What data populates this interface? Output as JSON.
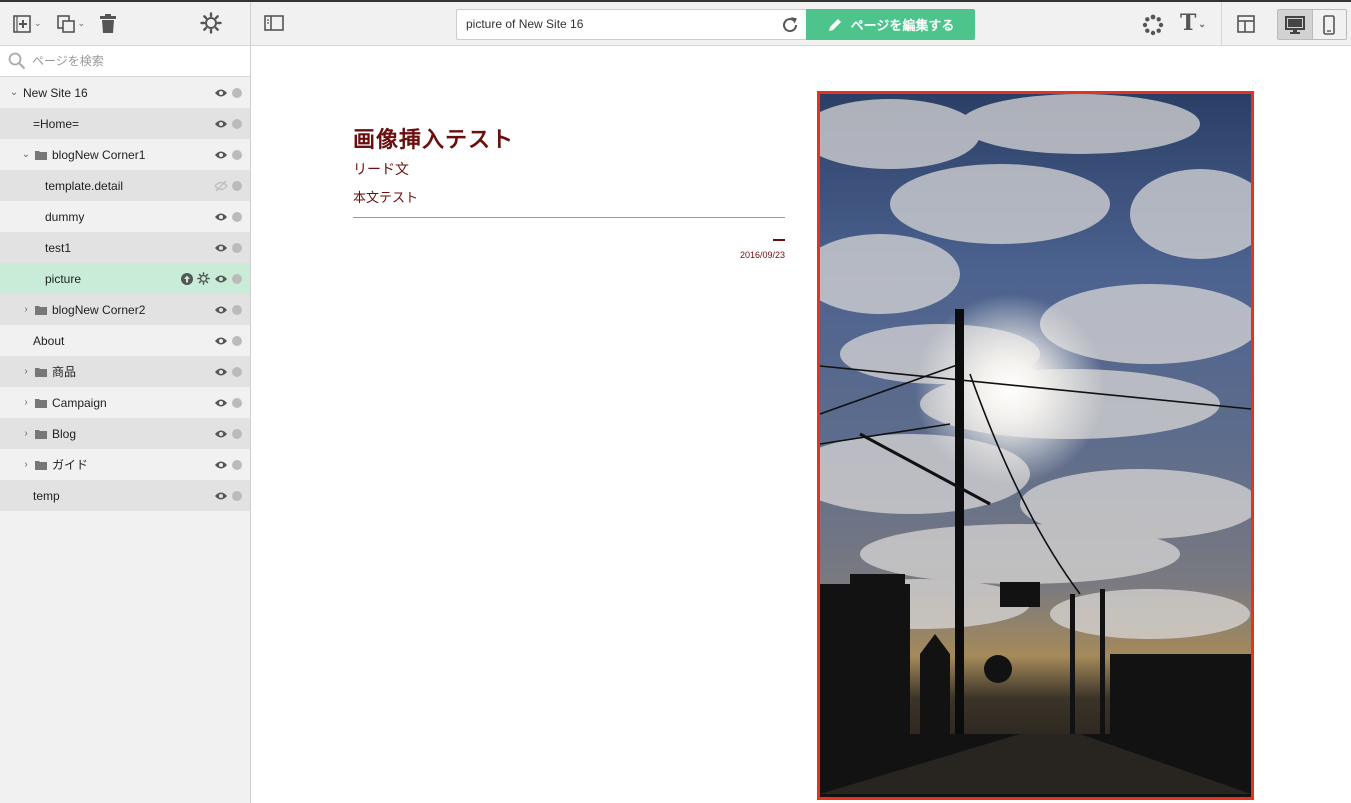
{
  "toolbar": {
    "add_page": "add-page-icon",
    "duplicate": "duplicate-icon",
    "delete": "trash-icon",
    "settings": "gear-icon",
    "caret": "⌄"
  },
  "search": {
    "placeholder": "ページを検索"
  },
  "tree": {
    "site_name": "New Site 16",
    "items": [
      {
        "label": "=Home="
      },
      {
        "label": "blogNew Corner1"
      },
      {
        "label": "template.detail"
      },
      {
        "label": "dummy"
      },
      {
        "label": "test1"
      },
      {
        "label": "picture"
      },
      {
        "label": "blogNew Corner2"
      },
      {
        "label": "About"
      },
      {
        "label": "商品"
      },
      {
        "label": "Campaign"
      },
      {
        "label": "Blog"
      },
      {
        "label": "ガイド"
      },
      {
        "label": "temp"
      }
    ]
  },
  "topbar": {
    "url_value": "picture of New Site 16",
    "edit_label": "ページを編集する",
    "font_label": "T"
  },
  "article": {
    "title": "画像挿入テスト",
    "lead": "リード文",
    "body": "本文テスト",
    "date": "2016/09/23"
  },
  "colors": {
    "accent_green": "#4cc48c",
    "selection_green": "#c9ecd9",
    "title_maroon": "#6b0e0e",
    "frame_red": "#e8331c"
  }
}
